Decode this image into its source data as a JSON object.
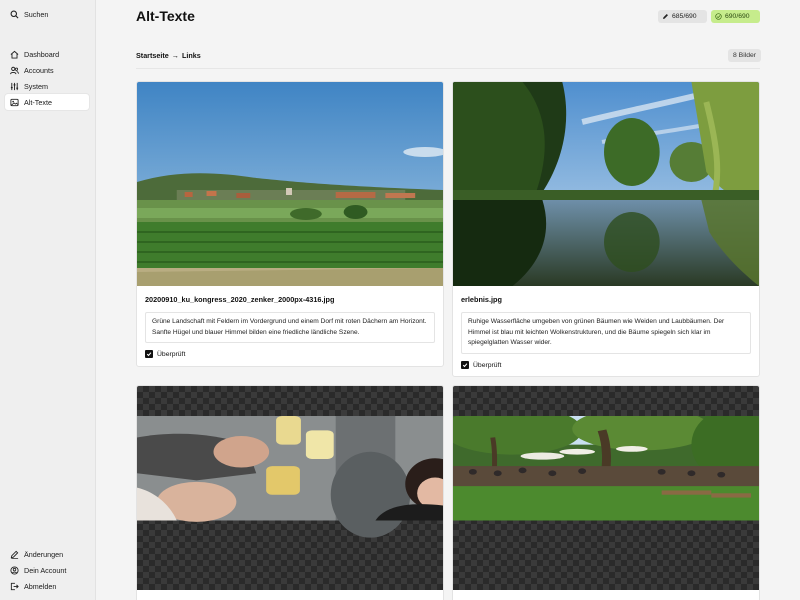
{
  "sidebar": {
    "search_label": "Suchen",
    "nav": [
      {
        "label": "Dashboard",
        "icon": "home-icon"
      },
      {
        "label": "Accounts",
        "icon": "users-icon"
      },
      {
        "label": "System",
        "icon": "sliders-icon"
      },
      {
        "label": "Alt-Texte",
        "icon": "image-icon",
        "active": true
      }
    ],
    "footer": [
      {
        "label": "Änderungen",
        "icon": "pencil-icon"
      },
      {
        "label": "Dein Account",
        "icon": "user-circle-icon"
      },
      {
        "label": "Abmelden",
        "icon": "logout-icon"
      }
    ]
  },
  "header": {
    "title": "Alt-Texte",
    "edited_count": "685/690",
    "checked_count": "690/690"
  },
  "breadcrumb": {
    "home": "Startseite",
    "separator": "→",
    "current": "Links",
    "count": "8 Bilder"
  },
  "cards": [
    {
      "filename": "20200910_ku_kongress_2020_zenker_2000px-4316.jpg",
      "alt_text": "Grüne Landschaft mit Feldern im Vordergrund und einem Dorf mit roten Dächern am Horizont. Sanfte Hügel und blauer Himmel bilden eine friedliche ländliche Szene.",
      "checkbox_label": "Überprüft",
      "checked": true
    },
    {
      "filename": "erlebnis.jpg",
      "alt_text": "Ruhige Wasserfläche umgeben von grünen Bäumen wie Weiden und Laubbäumen. Der Himmel ist blau mit leichten Wolkenstrukturen, und die Bäume spiegeln sich klar im spiegelglatten Wasser wider.",
      "checkbox_label": "Überprüft",
      "checked": true
    }
  ],
  "colors": {
    "accent_green": "#c6ec8c",
    "sidebar_bg": "#efefef"
  }
}
